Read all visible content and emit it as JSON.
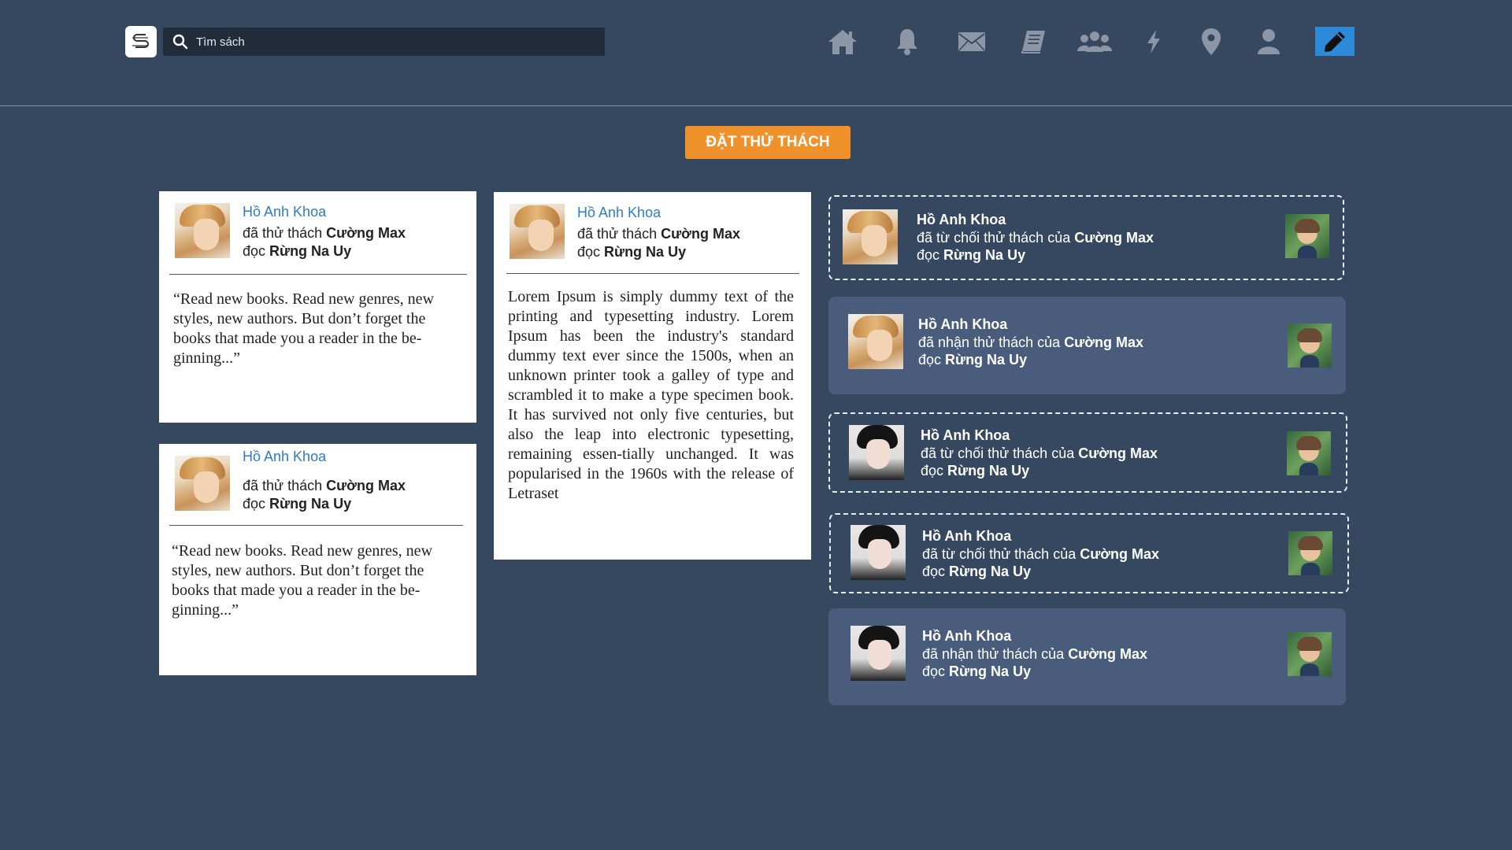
{
  "search": {
    "placeholder": "Tìm sách"
  },
  "nav": [
    "home-icon",
    "bell-icon",
    "mail-icon",
    "book-icon",
    "group-icon",
    "bolt-icon",
    "map-pin-icon",
    "user-icon",
    "pencil-icon"
  ],
  "colors": {
    "background": "#364760",
    "accent": "#f0922c",
    "active_nav": "#2c8ad8",
    "card_dark": "#4a5c7b",
    "name_link": "#2d7cc4"
  },
  "challenge_button": "ĐẶT THỬ THÁCH",
  "left_cards": [
    {
      "name": "Hồ Anh Khoa",
      "action": "đã thử thách ",
      "target": "Cường Max",
      "read": "đọc ",
      "book": "Rừng Na Uy",
      "quote": "“Read new books. Read new genres, new styles, new authors. But don’t forget the books that made you a reader in the be-ginning...”"
    },
    {
      "name": "Hồ Anh Khoa",
      "action": "đã thử thách ",
      "target": "Cường Max",
      "read": "đọc ",
      "book": "Rừng Na Uy",
      "quote": "“Read new books. Read new genres, new styles, new authors. But don’t forget the books that made you a reader in the be-ginning...”"
    }
  ],
  "middle_card": {
    "name": "Hồ Anh Khoa",
    "action": "đã thử thách ",
    "target": "Cường Max",
    "read": "đọc ",
    "book": "Rừng Na Uy",
    "text": "Lorem Ipsum is simply dummy text of the printing and typesetting industry. Lorem Ipsum has been the industry's standard dummy text ever since the 1500s, when an unknown printer took a galley of type and scrambled it to make a type specimen book. It has survived not only five centuries, but also the leap into electronic typesetting, remaining essen-tially unchanged. It was popularised in the 1960s with the release of Letraset"
  },
  "activities": [
    {
      "name": "Hồ Anh Khoa",
      "action": "đã từ chối thử thách của ",
      "target": "Cường Max",
      "read": "đọc ",
      "book": "Rừng Na Uy"
    },
    {
      "name": "Hồ Anh Khoa",
      "action": "đã nhận thử thách của ",
      "target": "Cường Max",
      "read": "đọc ",
      "book": "Rừng Na Uy"
    },
    {
      "name": "Hồ Anh Khoa",
      "action": "đã từ chối thử thách của ",
      "target": "Cường Max",
      "read": "đọc ",
      "book": "Rừng Na Uy"
    },
    {
      "name": "Hồ Anh Khoa",
      "action": "đã từ chối thử thách của ",
      "target": "Cường Max",
      "read": "đọc ",
      "book": "Rừng Na Uy"
    },
    {
      "name": "Hồ Anh Khoa",
      "action": "đã nhận thử thách của ",
      "target": "Cường Max",
      "read": "đọc ",
      "book": "Rừng Na Uy"
    }
  ]
}
